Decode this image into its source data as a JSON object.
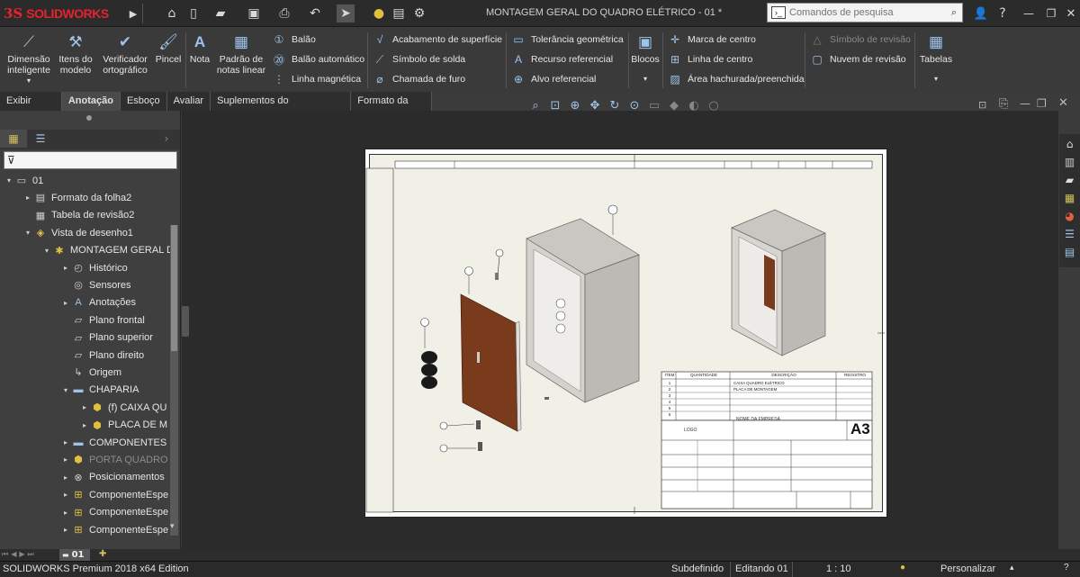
{
  "app": {
    "logo_ds": "3S",
    "logo_text": "SOLIDWORKS",
    "document_title": "MONTAGEM GERAL DO QUADRO ELÉTRICO - 01 *",
    "search_placeholder": "Comandos de pesquisa"
  },
  "ribbon": {
    "big_buttons": [
      {
        "label": "Dimensão inteligente",
        "icon": "smart-dimension-icon"
      },
      {
        "label": "Itens do modelo",
        "icon": "model-items-icon"
      },
      {
        "label": "Verificador ortográfico",
        "icon": "spell-checker-icon"
      },
      {
        "label": "Pincel",
        "icon": "format-painter-icon"
      },
      {
        "label": "Nota",
        "icon": "note-icon"
      },
      {
        "label": "Padrão de notas linear",
        "icon": "linear-note-pattern-icon"
      }
    ],
    "col1": [
      "Balão",
      "Balão automático",
      "Linha magnética"
    ],
    "col2": [
      "Acabamento de superfície",
      "Símbolo de solda",
      "Chamada de furo"
    ],
    "col3": [
      "Tolerância geométrica",
      "Recurso referencial",
      "Alvo referencial"
    ],
    "blocks": "Blocos",
    "col4": [
      "Marca de centro",
      "Linha de centro",
      "Área hachurada/preenchida"
    ],
    "col5": [
      "Símbolo de revisão",
      "Nuvem de revisão"
    ],
    "tables": "Tabelas"
  },
  "tabs": [
    "Exibir layout",
    "Anotação",
    "Esboço",
    "Avaliar",
    "Suplementos do SOLIDWORKS",
    "Formato da folha"
  ],
  "tree": [
    {
      "label": "01",
      "level": 0,
      "exp": "▾",
      "icon": "drawing-icon"
    },
    {
      "label": "Formato da folha2",
      "level": 1,
      "exp": "▸",
      "icon": "sheet-format-icon"
    },
    {
      "label": "Tabela de revisão2",
      "level": 1,
      "exp": "",
      "icon": "revision-table-icon"
    },
    {
      "label": "Vista de desenho1",
      "level": 1,
      "exp": "▾",
      "icon": "drawing-view-icon"
    },
    {
      "label": "MONTAGEM GERAL D",
      "level": 2,
      "exp": "▾",
      "icon": "assembly-icon"
    },
    {
      "label": "Histórico",
      "level": 3,
      "exp": "▸",
      "icon": "history-icon"
    },
    {
      "label": "Sensores",
      "level": 3,
      "exp": "",
      "icon": "sensors-icon"
    },
    {
      "label": "Anotações",
      "level": 3,
      "exp": "▸",
      "icon": "annotations-icon"
    },
    {
      "label": "Plano frontal",
      "level": 3,
      "exp": "",
      "icon": "plane-icon"
    },
    {
      "label": "Plano superior",
      "level": 3,
      "exp": "",
      "icon": "plane-icon"
    },
    {
      "label": "Plano direito",
      "level": 3,
      "exp": "",
      "icon": "plane-icon"
    },
    {
      "label": "Origem",
      "level": 3,
      "exp": "",
      "icon": "origin-icon"
    },
    {
      "label": "CHAPARIA",
      "level": 3,
      "exp": "▾",
      "icon": "folder-icon"
    },
    {
      "label": "(f) CAIXA QU",
      "level": 4,
      "exp": "▸",
      "icon": "part-icon"
    },
    {
      "label": "PLACA DE M",
      "level": 4,
      "exp": "▸",
      "icon": "part-icon"
    },
    {
      "label": "COMPONENTES",
      "level": 3,
      "exp": "▸",
      "icon": "folder-icon"
    },
    {
      "label": "PORTA QUADRO",
      "level": 3,
      "exp": "▸",
      "icon": "part-icon",
      "dim": true
    },
    {
      "label": "Posicionamentos",
      "level": 3,
      "exp": "▸",
      "icon": "mates-icon"
    },
    {
      "label": "ComponenteEspe",
      "level": 3,
      "exp": "▸",
      "icon": "pattern-icon"
    },
    {
      "label": "ComponenteEspe",
      "level": 3,
      "exp": "▸",
      "icon": "pattern-icon"
    },
    {
      "label": "ComponenteEspe",
      "level": 3,
      "exp": "▸",
      "icon": "pattern-icon"
    }
  ],
  "sheet_tab": "01",
  "status": {
    "edition": "SOLIDWORKS Premium 2018 x64 Edition",
    "state": "Subdefinido",
    "editing": "Editando 01",
    "scale": "1 : 10",
    "customize": "Personalizar"
  },
  "titleblock": {
    "bom_headers": [
      "ITEM",
      "QUANTIDADE",
      "DESCRIÇÃO",
      "REGISTRO"
    ],
    "bom_rows": [
      {
        "item": "1",
        "qty": "",
        "desc": "CAIXA QUADRO ELÉTRICO"
      },
      {
        "item": "2",
        "qty": "",
        "desc": "PLACA DE MONTAGEM"
      },
      {
        "item": "3",
        "qty": "",
        "desc": ""
      },
      {
        "item": "4",
        "qty": "",
        "desc": ""
      },
      {
        "item": "5",
        "qty": "",
        "desc": ""
      },
      {
        "item": "6",
        "qty": "",
        "desc": ""
      }
    ],
    "logo": "LOGO",
    "company": "NOME DA EMPRESA",
    "size": "A3"
  },
  "colors": {
    "accent": "#9fc4e8",
    "logo_red": "#e8222d",
    "door": "#7a3a1c"
  }
}
